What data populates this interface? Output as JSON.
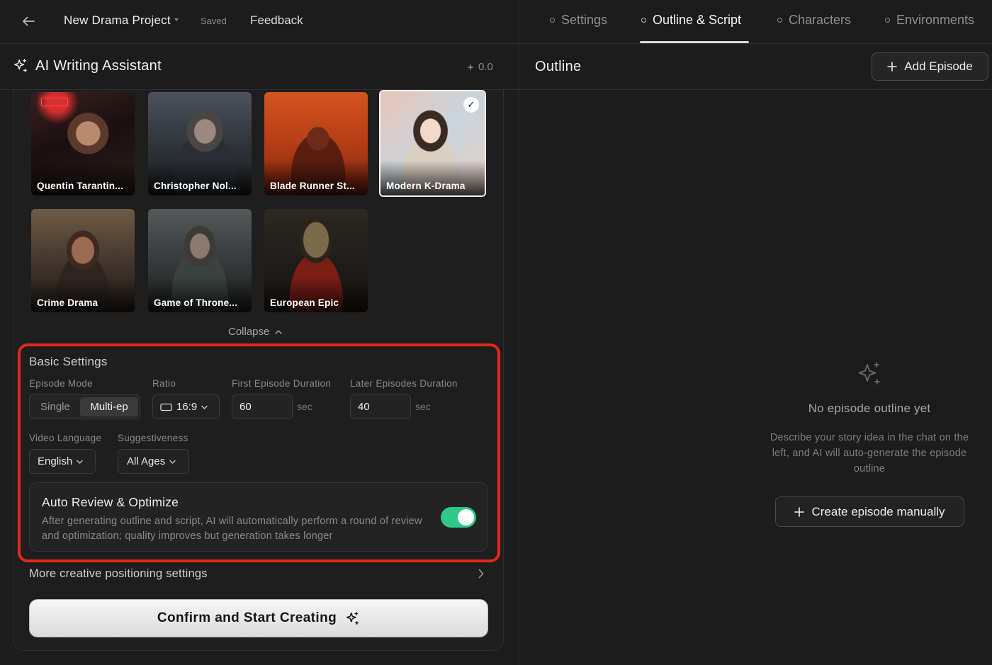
{
  "topbar": {
    "back_icon": "arrow-left-icon",
    "project_title": "New Drama Project",
    "save_status": "Saved",
    "feedback_label": "Feedback",
    "tabs": [
      {
        "label": "Settings",
        "active": false
      },
      {
        "label": "Outline & Script",
        "active": true
      },
      {
        "label": "Characters",
        "active": false
      },
      {
        "label": "Environments",
        "active": false
      }
    ]
  },
  "assistant": {
    "title": "AI Writing Assistant",
    "icon": "sparkles-icon",
    "credits": "0.0"
  },
  "styles": [
    {
      "label": "Quentin Tarantin...",
      "selected": false
    },
    {
      "label": "Christopher Nol...",
      "selected": false
    },
    {
      "label": "Blade Runner St...",
      "selected": false
    },
    {
      "label": "Modern K-Drama",
      "selected": true
    },
    {
      "label": "Crime Drama",
      "selected": false
    },
    {
      "label": "Game of Throne...",
      "selected": false
    },
    {
      "label": "European Epic",
      "selected": false
    }
  ],
  "collapse_label": "Collapse",
  "basic_settings": {
    "title": "Basic Settings",
    "episode_mode": {
      "label": "Episode Mode",
      "options": [
        "Single",
        "Multi-ep"
      ],
      "selected": "Multi-ep"
    },
    "ratio": {
      "label": "Ratio",
      "value": "16:9"
    },
    "first_duration": {
      "label": "First Episode Duration",
      "value": "60",
      "unit": "sec"
    },
    "later_duration": {
      "label": "Later Episodes Duration",
      "value": "40",
      "unit": "sec"
    },
    "video_language": {
      "label": "Video Language",
      "value": "English"
    },
    "suggestiveness": {
      "label": "Suggestiveness",
      "value": "All Ages"
    },
    "auto_review": {
      "title": "Auto Review & Optimize",
      "description": "After generating outline and script, AI will automatically perform a round of review and optimization; quality improves but generation takes longer",
      "enabled": true
    }
  },
  "more_settings_label": "More creative positioning settings",
  "confirm_label": "Confirm and Start Creating",
  "outline": {
    "title": "Outline",
    "add_episode_label": "Add Episode",
    "empty_title": "No episode outline yet",
    "empty_description": "Describe your story idea in the chat on the left, and AI will auto-generate the episode outline",
    "create_manual_label": "Create episode manually"
  },
  "colors": {
    "background": "#1c1c1c",
    "highlight_border": "#e5271c",
    "toggle_on": "#2fca88"
  }
}
